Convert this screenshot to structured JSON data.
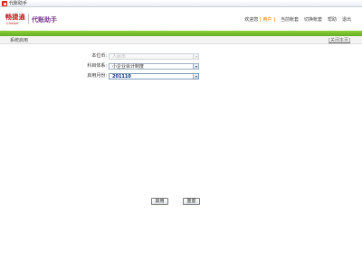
{
  "window": {
    "title": "代账助手"
  },
  "header": {
    "logo_text": "畅捷通",
    "logo_sub": "Chanjet",
    "app_name": "代账助手",
    "nav": {
      "welcome": "欢迎您",
      "user": "[ 用户 ]",
      "current_account": "当前帐套",
      "switch_account": "切换帐套",
      "help": "帮助",
      "logout": "退出"
    }
  },
  "page": {
    "title": "系统启用",
    "close_label": "[关闭本页]"
  },
  "form": {
    "org": {
      "label": "本位币:",
      "value": "人民币"
    },
    "system": {
      "label": "科目体系:",
      "value": "小企业会计制度"
    },
    "month": {
      "label": "启用月份:",
      "value": "201110"
    }
  },
  "buttons": {
    "enable": "启用",
    "reset": "重置"
  },
  "colors": {
    "brand_red": "#c0161c",
    "green_bar": "#64ad1f",
    "user_orange": "#e07b00"
  }
}
